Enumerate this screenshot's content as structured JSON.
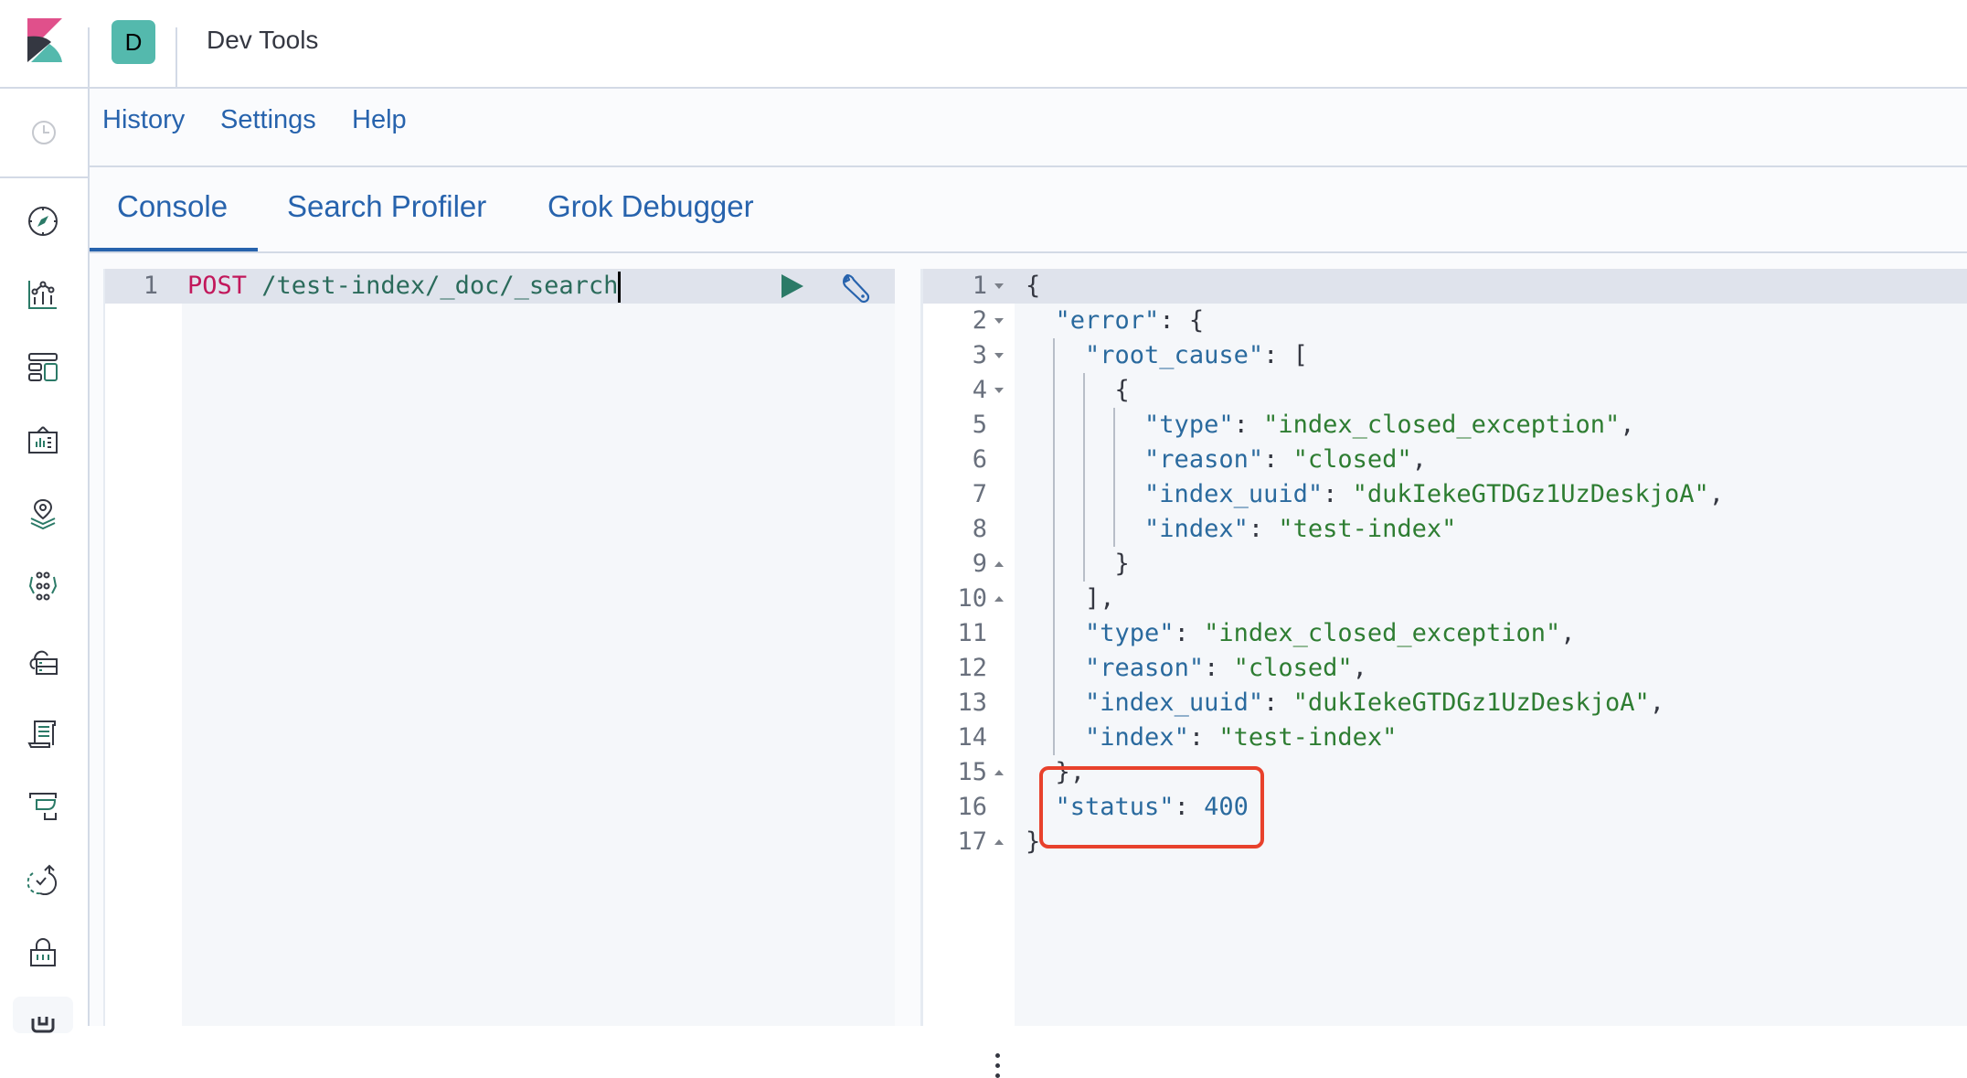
{
  "header": {
    "space_initial": "D",
    "app_title": "Dev Tools"
  },
  "sidebar": {
    "items": [
      {
        "name": "recently-viewed",
        "icon": "clock-icon"
      },
      {
        "name": "discover",
        "icon": "compass-icon"
      },
      {
        "name": "visualize",
        "icon": "visualize-icon"
      },
      {
        "name": "dashboard",
        "icon": "dashboard-icon"
      },
      {
        "name": "canvas",
        "icon": "canvas-icon"
      },
      {
        "name": "maps",
        "icon": "maps-icon"
      },
      {
        "name": "machine-learning",
        "icon": "ml-icon"
      },
      {
        "name": "infrastructure",
        "icon": "infrastructure-icon"
      },
      {
        "name": "logs",
        "icon": "logs-icon"
      },
      {
        "name": "apm",
        "icon": "apm-icon"
      },
      {
        "name": "uptime",
        "icon": "uptime-icon"
      },
      {
        "name": "siem",
        "icon": "siem-icon"
      },
      {
        "name": "dev-tools",
        "icon": "dev-tools-icon",
        "active": true
      }
    ]
  },
  "topnav": {
    "history": "History",
    "settings": "Settings",
    "help": "Help"
  },
  "tabs": [
    {
      "label": "Console",
      "active": true
    },
    {
      "label": "Search Profiler",
      "active": false
    },
    {
      "label": "Grok Debugger",
      "active": false
    }
  ],
  "request": {
    "line_number": "1",
    "method": "POST",
    "path": " /test-index/_doc/_search"
  },
  "response": {
    "lines": [
      {
        "n": "1",
        "fold": "down"
      },
      {
        "n": "2",
        "fold": "down"
      },
      {
        "n": "3",
        "fold": "down"
      },
      {
        "n": "4",
        "fold": "down"
      },
      {
        "n": "5"
      },
      {
        "n": "6"
      },
      {
        "n": "7"
      },
      {
        "n": "8"
      },
      {
        "n": "9",
        "fold": "up"
      },
      {
        "n": "10",
        "fold": "up"
      },
      {
        "n": "11"
      },
      {
        "n": "12"
      },
      {
        "n": "13"
      },
      {
        "n": "14"
      },
      {
        "n": "15",
        "fold": "up"
      },
      {
        "n": "16"
      },
      {
        "n": "17",
        "fold": "up"
      }
    ],
    "tokens": {
      "open_brace": "{",
      "close_brace": "}",
      "error_key": "\"error\"",
      "root_cause_key": "\"root_cause\"",
      "type_key": "\"type\"",
      "reason_key": "\"reason\"",
      "index_uuid_key": "\"index_uuid\"",
      "index_key": "\"index\"",
      "status_key": "\"status\"",
      "type_value": "\"index_closed_exception\"",
      "reason_value": "\"closed\"",
      "index_uuid_value": "\"dukIekeGTDGz1UzDeskjoA\"",
      "index_value": "\"test-index\"",
      "status_value": "400"
    }
  },
  "colors": {
    "accent": "#2763ad",
    "highlight_box": "#e8412c",
    "json_key": "#2a6a9e",
    "json_string": "#2e7d32",
    "method": "#c2185b"
  }
}
